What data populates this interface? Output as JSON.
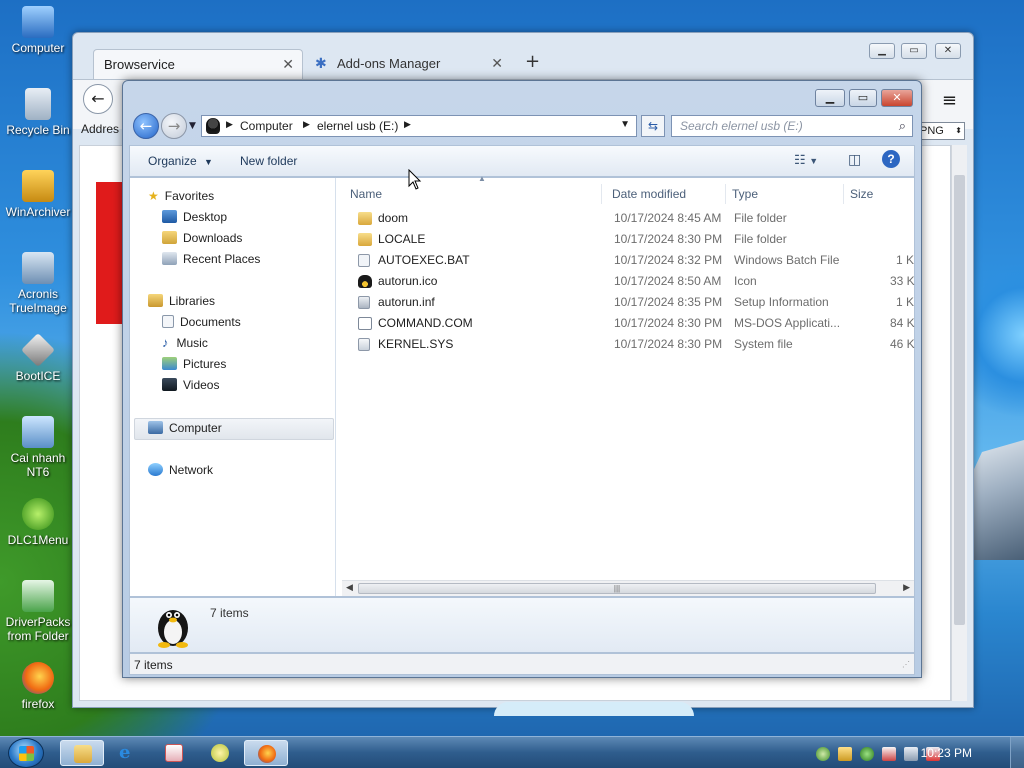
{
  "desktop": {
    "icons": [
      {
        "label": "Computer"
      },
      {
        "label": "Recycle Bin"
      },
      {
        "label": "WinArchiver"
      },
      {
        "label": "Acronis TrueImage"
      },
      {
        "label": "BootICE"
      },
      {
        "label": "Cai nhanh NT6"
      },
      {
        "label": "DLC1Menu"
      },
      {
        "label": "DriverPacks from Folder"
      },
      {
        "label": "firefox"
      }
    ]
  },
  "firefox": {
    "tabs": [
      {
        "label": "Browservice",
        "active": true
      },
      {
        "label": "Add-ons Manager",
        "active": false
      }
    ],
    "new_tab": "+",
    "address_label": "Addres",
    "format_select": "PNG",
    "back_glyph": "←",
    "menu_glyph": "≡"
  },
  "explorer": {
    "address": {
      "segments": [
        "Computer",
        "elernel usb (E:)"
      ]
    },
    "search_placeholder": "Search elernel usb (E:)",
    "toolbar": {
      "organize": "Organize",
      "new_folder": "New folder"
    },
    "nav": {
      "favorites": {
        "label": "Favorites",
        "items": [
          "Desktop",
          "Downloads",
          "Recent Places"
        ]
      },
      "libraries": {
        "label": "Libraries",
        "items": [
          "Documents",
          "Music",
          "Pictures",
          "Videos"
        ]
      },
      "computer": "Computer",
      "network": "Network"
    },
    "columns": [
      "Name",
      "Date modified",
      "Type",
      "Size"
    ],
    "files": [
      {
        "name": "doom",
        "date": "10/17/2024 8:45 AM",
        "type": "File folder",
        "size": "",
        "icon": "folder-icon"
      },
      {
        "name": "LOCALE",
        "date": "10/17/2024 8:30 PM",
        "type": "File folder",
        "size": "",
        "icon": "folder-icon"
      },
      {
        "name": "AUTOEXEC.BAT",
        "date": "10/17/2024 8:32 PM",
        "type": "Windows Batch File",
        "size": "1 K",
        "icon": "batch-file-icon"
      },
      {
        "name": "autorun.ico",
        "date": "10/17/2024 8:50 AM",
        "type": "Icon",
        "size": "33 K",
        "icon": "tux-icon"
      },
      {
        "name": "autorun.inf",
        "date": "10/17/2024 8:35 PM",
        "type": "Setup Information",
        "size": "1 K",
        "icon": "setup-file-icon"
      },
      {
        "name": "COMMAND.COM",
        "date": "10/17/2024 8:30 PM",
        "type": "MS-DOS Applicati...",
        "size": "84 K",
        "icon": "dos-app-icon"
      },
      {
        "name": "KERNEL.SYS",
        "date": "10/17/2024 8:30 PM",
        "type": "System file",
        "size": "46 K",
        "icon": "system-file-icon"
      }
    ],
    "details_count": "7 items",
    "status_count": "7 items"
  },
  "taskbar": {
    "clock": "10:23 PM"
  },
  "colors": {
    "accent": "#2364c8",
    "folder": "#e8c04a",
    "close_red": "#c9452f"
  }
}
